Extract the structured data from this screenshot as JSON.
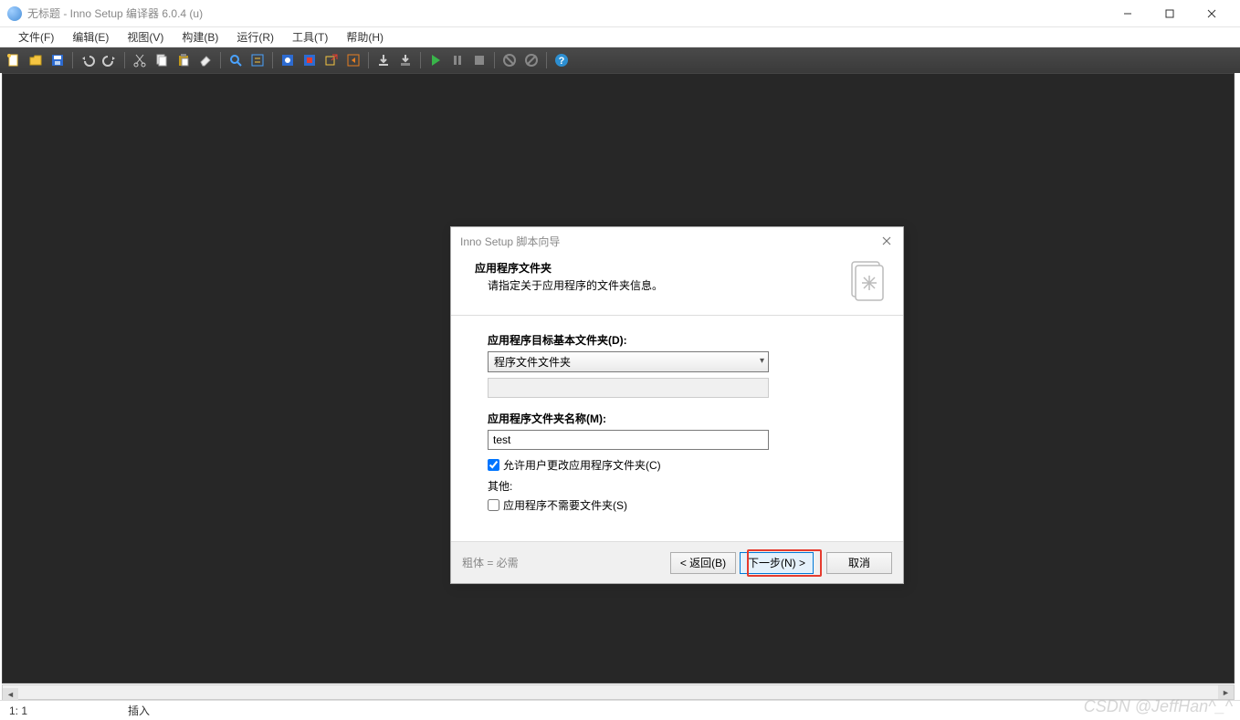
{
  "window": {
    "title": "无标题 - Inno Setup 编译器 6.0.4 (u)"
  },
  "menu": {
    "file": "文件(F)",
    "edit": "编辑(E)",
    "view": "视图(V)",
    "build": "构建(B)",
    "run": "运行(R)",
    "tools": "工具(T)",
    "help": "帮助(H)"
  },
  "statusbar": {
    "pos": "1:   1",
    "mode": "插入"
  },
  "watermark": "CSDN @JeffHan^_^",
  "dialog": {
    "title": "Inno Setup 脚本向导",
    "heading": "应用程序文件夹",
    "subheading": "请指定关于应用程序的文件夹信息。",
    "label_destbase": "应用程序目标基本文件夹(D):",
    "select_value": "程序文件文件夹",
    "label_foldername": "应用程序文件夹名称(M):",
    "input_value": "test",
    "chk_allowchange": "允许用户更改应用程序文件夹(C)",
    "other_label": "其他:",
    "chk_nofolder": "应用程序不需要文件夹(S)",
    "required_note": "粗体 = 必需",
    "btn_back": "< 返回(B)",
    "btn_next": "下一步(N) >",
    "btn_cancel": "取消"
  }
}
